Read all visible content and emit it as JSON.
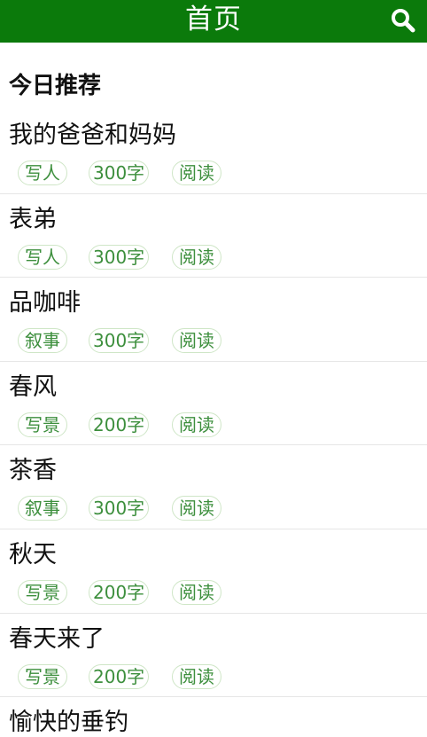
{
  "header": {
    "title": "首页",
    "search_icon": "search-icon",
    "bg_color": "#0b7a0b"
  },
  "section_title": "今日推荐",
  "items": [
    {
      "title": "我的爸爸和妈妈",
      "category": "写人",
      "words": "300字",
      "action": "阅读"
    },
    {
      "title": "表弟",
      "category": "写人",
      "words": "300字",
      "action": "阅读"
    },
    {
      "title": "品咖啡",
      "category": "叙事",
      "words": "300字",
      "action": "阅读"
    },
    {
      "title": "春风",
      "category": "写景",
      "words": "200字",
      "action": "阅读"
    },
    {
      "title": "茶香",
      "category": "叙事",
      "words": "300字",
      "action": "阅读"
    },
    {
      "title": "秋天",
      "category": "写景",
      "words": "200字",
      "action": "阅读"
    },
    {
      "title": "春天来了",
      "category": "写景",
      "words": "200字",
      "action": "阅读"
    },
    {
      "title": "愉快的垂钓",
      "category": "",
      "words": "",
      "action": ""
    }
  ],
  "colors": {
    "accent": "#0b7a0b",
    "tag_text": "#3d8f3d",
    "tag_border": "#cfe6c7"
  }
}
